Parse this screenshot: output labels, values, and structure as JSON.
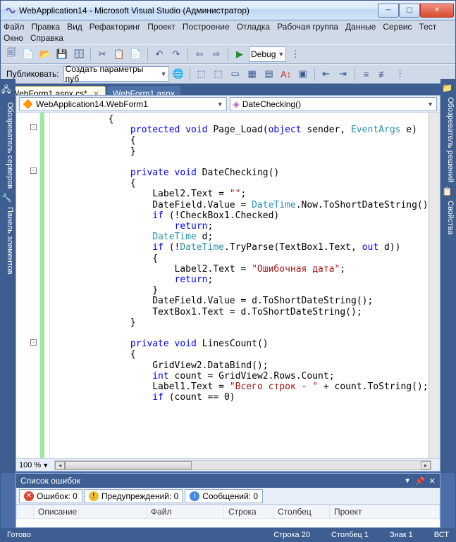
{
  "window": {
    "title": "WebApplication14 - Microsoft Visual Studio (Администратор)"
  },
  "menu": {
    "items": [
      "Файл",
      "Правка",
      "Вид",
      "Рефакторинг",
      "Проект",
      "Построение",
      "Отладка",
      "Рабочая группа",
      "Данные",
      "Сервис",
      "Тест",
      "Окно",
      "Справка"
    ]
  },
  "toolbar1": {
    "config_label": "Debug"
  },
  "toolbar2": {
    "publish_label": "Публиковать:",
    "publish_target": "Создать параметры пуб"
  },
  "tabs": [
    {
      "label": "WebForm1.aspx.cs*",
      "active": true,
      "closable": true
    },
    {
      "label": "WebForm1.aspx",
      "active": false,
      "closable": false
    }
  ],
  "nav": {
    "left": "WebApplication14.WebForm1",
    "right": "DateChecking()"
  },
  "code_lines": [
    {
      "indent": 2,
      "tokens": [
        {
          "t": "{",
          "c": ""
        }
      ]
    },
    {
      "indent": 3,
      "tokens": [
        {
          "t": "protected",
          "c": "kw"
        },
        {
          "t": " "
        },
        {
          "t": "void",
          "c": "kw"
        },
        {
          "t": " Page_Load("
        },
        {
          "t": "object",
          "c": "kw"
        },
        {
          "t": " sender, "
        },
        {
          "t": "EventArgs",
          "c": "type"
        },
        {
          "t": " e)"
        }
      ]
    },
    {
      "indent": 3,
      "tokens": [
        {
          "t": "{"
        }
      ]
    },
    {
      "indent": 3,
      "tokens": [
        {
          "t": "}"
        }
      ]
    },
    {
      "indent": 0,
      "tokens": [
        {
          "t": ""
        }
      ]
    },
    {
      "indent": 3,
      "tokens": [
        {
          "t": "private",
          "c": "kw"
        },
        {
          "t": " "
        },
        {
          "t": "void",
          "c": "kw"
        },
        {
          "t": " DateChecking()"
        }
      ]
    },
    {
      "indent": 3,
      "tokens": [
        {
          "t": "{"
        }
      ]
    },
    {
      "indent": 4,
      "tokens": [
        {
          "t": "Label2.Text = "
        },
        {
          "t": "\"\"",
          "c": "str"
        },
        {
          "t": ";"
        }
      ]
    },
    {
      "indent": 4,
      "tokens": [
        {
          "t": "DateField.Value = "
        },
        {
          "t": "DateTime",
          "c": "type"
        },
        {
          "t": ".Now.ToShortDateString();"
        }
      ]
    },
    {
      "indent": 4,
      "tokens": [
        {
          "t": "if",
          "c": "kw"
        },
        {
          "t": " (!CheckBox1.Checked)"
        }
      ]
    },
    {
      "indent": 5,
      "tokens": [
        {
          "t": "return",
          "c": "kw"
        },
        {
          "t": ";"
        }
      ]
    },
    {
      "indent": 4,
      "tokens": [
        {
          "t": "DateTime",
          "c": "type"
        },
        {
          "t": " d;"
        }
      ]
    },
    {
      "indent": 4,
      "tokens": [
        {
          "t": "if",
          "c": "kw"
        },
        {
          "t": " (!"
        },
        {
          "t": "DateTime",
          "c": "type"
        },
        {
          "t": ".TryParse(TextBox1.Text, "
        },
        {
          "t": "out",
          "c": "kw"
        },
        {
          "t": " d))"
        }
      ]
    },
    {
      "indent": 4,
      "tokens": [
        {
          "t": "{"
        }
      ]
    },
    {
      "indent": 5,
      "tokens": [
        {
          "t": "Label2.Text = "
        },
        {
          "t": "\"Ошибочная дата\"",
          "c": "str"
        },
        {
          "t": ";"
        }
      ]
    },
    {
      "indent": 5,
      "tokens": [
        {
          "t": "return",
          "c": "kw"
        },
        {
          "t": ";"
        }
      ]
    },
    {
      "indent": 4,
      "tokens": [
        {
          "t": "}"
        }
      ]
    },
    {
      "indent": 4,
      "tokens": [
        {
          "t": "DateField.Value = d.ToShortDateString();"
        }
      ]
    },
    {
      "indent": 4,
      "tokens": [
        {
          "t": "TextBox1.Text = d.ToShortDateString();"
        }
      ]
    },
    {
      "indent": 3,
      "tokens": [
        {
          "t": "}"
        }
      ]
    },
    {
      "indent": 0,
      "tokens": [
        {
          "t": ""
        }
      ]
    },
    {
      "indent": 3,
      "tokens": [
        {
          "t": "private",
          "c": "kw"
        },
        {
          "t": " "
        },
        {
          "t": "void",
          "c": "kw"
        },
        {
          "t": " LinesCount()"
        }
      ]
    },
    {
      "indent": 3,
      "tokens": [
        {
          "t": "{"
        }
      ]
    },
    {
      "indent": 4,
      "tokens": [
        {
          "t": "GridView2.DataBind();"
        }
      ]
    },
    {
      "indent": 4,
      "tokens": [
        {
          "t": "int",
          "c": "kw"
        },
        {
          "t": " count = GridView2.Rows.Count;"
        }
      ]
    },
    {
      "indent": 4,
      "tokens": [
        {
          "t": "Label1.Text = "
        },
        {
          "t": "\"Всего строк - \"",
          "c": "str"
        },
        {
          "t": " + count.ToString();"
        }
      ]
    },
    {
      "indent": 4,
      "tokens": [
        {
          "t": "if",
          "c": "kw"
        },
        {
          "t": " (count == 0)"
        }
      ]
    }
  ],
  "zoom": "100 %",
  "side_left": [
    {
      "icon": "🖧",
      "label": "Обозреватель серверов"
    },
    {
      "icon": "🔧",
      "label": "Панель элементов"
    }
  ],
  "side_right": [
    {
      "icon": "📁",
      "label": "Обозреватель решений"
    },
    {
      "icon": "📋",
      "label": "Свойства"
    }
  ],
  "errorlist": {
    "title": "Список ошибок",
    "filters": {
      "errors": "Ошибок: 0",
      "warnings": "Предупреждений: 0",
      "messages": "Сообщений: 0"
    },
    "columns": [
      "",
      "Описание",
      "Файл",
      "Строка",
      "Столбец",
      "Проект"
    ]
  },
  "statusbar": {
    "ready": "Готово",
    "line": "Строка 20",
    "col": "Столбец 1",
    "char": "Знак 1",
    "ins": "ВСТ"
  }
}
